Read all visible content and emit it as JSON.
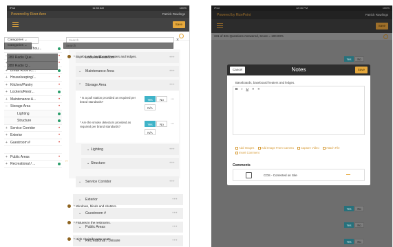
{
  "left": {
    "status": {
      "carrier": "iPad",
      "time": "11:53 AM",
      "battery": "100%"
    },
    "app_title": "Powered by Rizer Aero",
    "user_name": "Patrick Rawlings",
    "save_label": "Save",
    "categories_label": "Categories",
    "search_placeholder": "Search",
    "tree": [
      {
        "label": "Pre-Walk Thou...",
        "toggle": "",
        "status": "green",
        "style": "ind"
      },
      {
        "label": "Employee Areas",
        "toggle": "–",
        "status": "red",
        "style": ""
      },
      {
        "label": "Back Office",
        "toggle": "+",
        "status": "red",
        "style": ""
      },
      {
        "label": "Break Room/C...",
        "toggle": "+",
        "status": "green",
        "style": ""
      },
      {
        "label": "Housekeeping/...",
        "toggle": "+",
        "status": "red",
        "style": ""
      },
      {
        "label": "Kitchen/Pantry",
        "toggle": "+",
        "status": "red",
        "style": ""
      },
      {
        "label": "Lockers/Restr...",
        "toggle": "+",
        "status": "green",
        "style": ""
      },
      {
        "label": "Maintenance A...",
        "toggle": "+",
        "status": "red",
        "style": ""
      },
      {
        "label": "Storage Area",
        "toggle": "–",
        "status": "red",
        "style": ""
      },
      {
        "label": "Lighting",
        "toggle": "",
        "status": "green",
        "style": "sub"
      },
      {
        "label": "Structure",
        "toggle": "",
        "status": "green",
        "style": "sub"
      },
      {
        "label": "Service Corridor",
        "toggle": "+",
        "status": "red",
        "style": ""
      },
      {
        "label": "Exterior",
        "toggle": "+",
        "status": "red",
        "style": ""
      },
      {
        "label": "Guestroom #",
        "toggle": "+",
        "status": "red",
        "style": ""
      },
      {
        "label": "",
        "toggle": "",
        "status": "",
        "style": ""
      },
      {
        "label": "Public Areas",
        "toggle": "+",
        "status": "red",
        "style": ""
      },
      {
        "label": "Recreational / ...",
        "toggle": "+",
        "status": "green",
        "style": ""
      }
    ],
    "sections": {
      "lockers": "Lockers/Restroom",
      "maintenance": "Maintenance Area",
      "storage": "Storage Area",
      "lighting": "Lighting",
      "structure": "Structure",
      "service": "Service Corridor",
      "exterior": "Exterior",
      "guestroom": "Guestroom #",
      "public": "Public Areas",
      "recreational": "Recreational / Leisure"
    },
    "questions": [
      {
        "text": "* Is a pull station provided as required per brand standards?",
        "yes": "Yes",
        "no": "No",
        "na": "N/A"
      },
      {
        "text": "* Are the smoke detectors provided as required per brand standards?",
        "yes": "Yes",
        "no": "No",
        "na": "N/A"
      }
    ]
  },
  "right": {
    "status": {
      "carrier": "iPad",
      "time": "12:06 PM",
      "battery": "100%"
    },
    "app_title": "Powered by RizePoint",
    "user_name": "Patrick Rawlings",
    "save_label": "Save",
    "answered": "331 of 331 Questions Answered, Score = 100.00%",
    "categories_label": "Categories",
    "search_placeholder": "Search",
    "tree": [
      {
        "label": "280 Radio Que..."
      },
      {
        "label": "280 Radio Q..."
      }
    ],
    "bg_questions": [
      {
        "text": "* Baseboards, baseboard heaters and ledges.",
        "yes": "Yes",
        "no": "No"
      },
      {
        "text": "* Windows, blinds and shutters.",
        "yes": "Yes",
        "no": "No"
      },
      {
        "text": "* Fixtures in the restrooms.",
        "yes": "Yes",
        "no": "No"
      },
      {
        "text": "* High chairs/booster seats",
        "yes": "Yes",
        "no": "No"
      }
    ],
    "modal": {
      "cancel_label": "Cancel",
      "title": "Notes",
      "save_label": "Save",
      "question": "Baseboards, baseboard heaters and ledges.",
      "rte_tools": [
        "B",
        "I",
        "U",
        "≡",
        "≡"
      ],
      "attachments": [
        "Add Images",
        "Add Image From Camera",
        "Capture Video",
        "Attach File",
        "Insert Comment"
      ],
      "comments_label": "Comments",
      "comment_text": "COS - Corrected on Site"
    }
  },
  "colors": {
    "accent": "#e6a83c",
    "yes_active": "#3fb3c8",
    "danger": "#d9453c",
    "success": "#2a9d6a"
  }
}
